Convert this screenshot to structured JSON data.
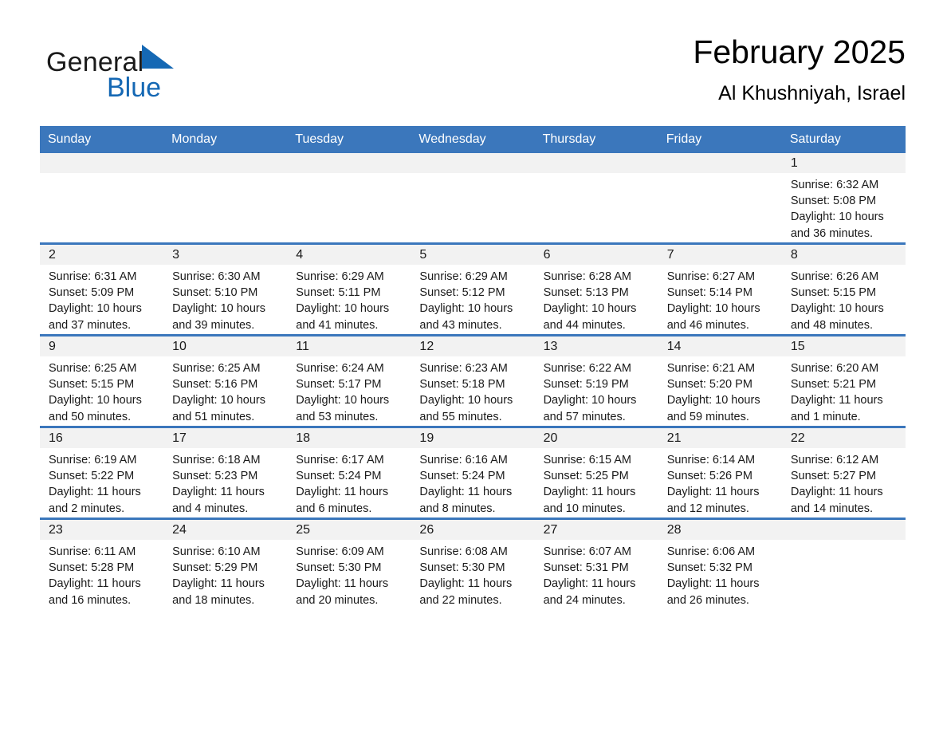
{
  "brand": {
    "name_part1": "General",
    "name_part2": "Blue",
    "logo_icon": "triangle-flag-icon",
    "color_primary": "#1568b4",
    "color_text": "#1a1a1a"
  },
  "header": {
    "title": "February 2025",
    "subtitle": "Al Khushniyah, Israel"
  },
  "theme": {
    "header_bg": "#3b77bc",
    "daynum_bg": "#f2f2f2",
    "row_border": "#3b77bc",
    "page_bg": "#ffffff"
  },
  "weekday_headers": [
    "Sunday",
    "Monday",
    "Tuesday",
    "Wednesday",
    "Thursday",
    "Friday",
    "Saturday"
  ],
  "days": [
    {
      "num": "",
      "sunrise": "",
      "sunset": "",
      "daylight1": "",
      "daylight2": "",
      "blank": true
    },
    {
      "num": "",
      "sunrise": "",
      "sunset": "",
      "daylight1": "",
      "daylight2": "",
      "blank": true
    },
    {
      "num": "",
      "sunrise": "",
      "sunset": "",
      "daylight1": "",
      "daylight2": "",
      "blank": true
    },
    {
      "num": "",
      "sunrise": "",
      "sunset": "",
      "daylight1": "",
      "daylight2": "",
      "blank": true
    },
    {
      "num": "",
      "sunrise": "",
      "sunset": "",
      "daylight1": "",
      "daylight2": "",
      "blank": true
    },
    {
      "num": "",
      "sunrise": "",
      "sunset": "",
      "daylight1": "",
      "daylight2": "",
      "blank": true
    },
    {
      "num": "1",
      "sunrise": "Sunrise: 6:32 AM",
      "sunset": "Sunset: 5:08 PM",
      "daylight1": "Daylight: 10 hours",
      "daylight2": "and 36 minutes.",
      "blank": false
    },
    {
      "num": "2",
      "sunrise": "Sunrise: 6:31 AM",
      "sunset": "Sunset: 5:09 PM",
      "daylight1": "Daylight: 10 hours",
      "daylight2": "and 37 minutes.",
      "blank": false
    },
    {
      "num": "3",
      "sunrise": "Sunrise: 6:30 AM",
      "sunset": "Sunset: 5:10 PM",
      "daylight1": "Daylight: 10 hours",
      "daylight2": "and 39 minutes.",
      "blank": false
    },
    {
      "num": "4",
      "sunrise": "Sunrise: 6:29 AM",
      "sunset": "Sunset: 5:11 PM",
      "daylight1": "Daylight: 10 hours",
      "daylight2": "and 41 minutes.",
      "blank": false
    },
    {
      "num": "5",
      "sunrise": "Sunrise: 6:29 AM",
      "sunset": "Sunset: 5:12 PM",
      "daylight1": "Daylight: 10 hours",
      "daylight2": "and 43 minutes.",
      "blank": false
    },
    {
      "num": "6",
      "sunrise": "Sunrise: 6:28 AM",
      "sunset": "Sunset: 5:13 PM",
      "daylight1": "Daylight: 10 hours",
      "daylight2": "and 44 minutes.",
      "blank": false
    },
    {
      "num": "7",
      "sunrise": "Sunrise: 6:27 AM",
      "sunset": "Sunset: 5:14 PM",
      "daylight1": "Daylight: 10 hours",
      "daylight2": "and 46 minutes.",
      "blank": false
    },
    {
      "num": "8",
      "sunrise": "Sunrise: 6:26 AM",
      "sunset": "Sunset: 5:15 PM",
      "daylight1": "Daylight: 10 hours",
      "daylight2": "and 48 minutes.",
      "blank": false
    },
    {
      "num": "9",
      "sunrise": "Sunrise: 6:25 AM",
      "sunset": "Sunset: 5:15 PM",
      "daylight1": "Daylight: 10 hours",
      "daylight2": "and 50 minutes.",
      "blank": false
    },
    {
      "num": "10",
      "sunrise": "Sunrise: 6:25 AM",
      "sunset": "Sunset: 5:16 PM",
      "daylight1": "Daylight: 10 hours",
      "daylight2": "and 51 minutes.",
      "blank": false
    },
    {
      "num": "11",
      "sunrise": "Sunrise: 6:24 AM",
      "sunset": "Sunset: 5:17 PM",
      "daylight1": "Daylight: 10 hours",
      "daylight2": "and 53 minutes.",
      "blank": false
    },
    {
      "num": "12",
      "sunrise": "Sunrise: 6:23 AM",
      "sunset": "Sunset: 5:18 PM",
      "daylight1": "Daylight: 10 hours",
      "daylight2": "and 55 minutes.",
      "blank": false
    },
    {
      "num": "13",
      "sunrise": "Sunrise: 6:22 AM",
      "sunset": "Sunset: 5:19 PM",
      "daylight1": "Daylight: 10 hours",
      "daylight2": "and 57 minutes.",
      "blank": false
    },
    {
      "num": "14",
      "sunrise": "Sunrise: 6:21 AM",
      "sunset": "Sunset: 5:20 PM",
      "daylight1": "Daylight: 10 hours",
      "daylight2": "and 59 minutes.",
      "blank": false
    },
    {
      "num": "15",
      "sunrise": "Sunrise: 6:20 AM",
      "sunset": "Sunset: 5:21 PM",
      "daylight1": "Daylight: 11 hours",
      "daylight2": "and 1 minute.",
      "blank": false
    },
    {
      "num": "16",
      "sunrise": "Sunrise: 6:19 AM",
      "sunset": "Sunset: 5:22 PM",
      "daylight1": "Daylight: 11 hours",
      "daylight2": "and 2 minutes.",
      "blank": false
    },
    {
      "num": "17",
      "sunrise": "Sunrise: 6:18 AM",
      "sunset": "Sunset: 5:23 PM",
      "daylight1": "Daylight: 11 hours",
      "daylight2": "and 4 minutes.",
      "blank": false
    },
    {
      "num": "18",
      "sunrise": "Sunrise: 6:17 AM",
      "sunset": "Sunset: 5:24 PM",
      "daylight1": "Daylight: 11 hours",
      "daylight2": "and 6 minutes.",
      "blank": false
    },
    {
      "num": "19",
      "sunrise": "Sunrise: 6:16 AM",
      "sunset": "Sunset: 5:24 PM",
      "daylight1": "Daylight: 11 hours",
      "daylight2": "and 8 minutes.",
      "blank": false
    },
    {
      "num": "20",
      "sunrise": "Sunrise: 6:15 AM",
      "sunset": "Sunset: 5:25 PM",
      "daylight1": "Daylight: 11 hours",
      "daylight2": "and 10 minutes.",
      "blank": false
    },
    {
      "num": "21",
      "sunrise": "Sunrise: 6:14 AM",
      "sunset": "Sunset: 5:26 PM",
      "daylight1": "Daylight: 11 hours",
      "daylight2": "and 12 minutes.",
      "blank": false
    },
    {
      "num": "22",
      "sunrise": "Sunrise: 6:12 AM",
      "sunset": "Sunset: 5:27 PM",
      "daylight1": "Daylight: 11 hours",
      "daylight2": "and 14 minutes.",
      "blank": false
    },
    {
      "num": "23",
      "sunrise": "Sunrise: 6:11 AM",
      "sunset": "Sunset: 5:28 PM",
      "daylight1": "Daylight: 11 hours",
      "daylight2": "and 16 minutes.",
      "blank": false
    },
    {
      "num": "24",
      "sunrise": "Sunrise: 6:10 AM",
      "sunset": "Sunset: 5:29 PM",
      "daylight1": "Daylight: 11 hours",
      "daylight2": "and 18 minutes.",
      "blank": false
    },
    {
      "num": "25",
      "sunrise": "Sunrise: 6:09 AM",
      "sunset": "Sunset: 5:30 PM",
      "daylight1": "Daylight: 11 hours",
      "daylight2": "and 20 minutes.",
      "blank": false
    },
    {
      "num": "26",
      "sunrise": "Sunrise: 6:08 AM",
      "sunset": "Sunset: 5:30 PM",
      "daylight1": "Daylight: 11 hours",
      "daylight2": "and 22 minutes.",
      "blank": false
    },
    {
      "num": "27",
      "sunrise": "Sunrise: 6:07 AM",
      "sunset": "Sunset: 5:31 PM",
      "daylight1": "Daylight: 11 hours",
      "daylight2": "and 24 minutes.",
      "blank": false
    },
    {
      "num": "28",
      "sunrise": "Sunrise: 6:06 AM",
      "sunset": "Sunset: 5:32 PM",
      "daylight1": "Daylight: 11 hours",
      "daylight2": "and 26 minutes.",
      "blank": false
    },
    {
      "num": "",
      "sunrise": "",
      "sunset": "",
      "daylight1": "",
      "daylight2": "",
      "blank": true
    }
  ]
}
